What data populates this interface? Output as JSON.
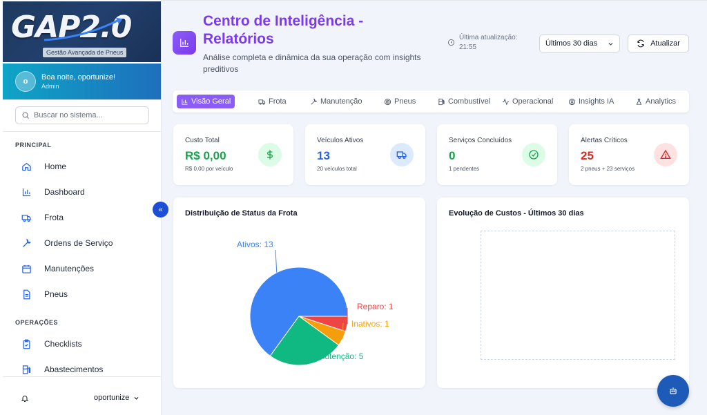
{
  "sidebar": {
    "logo_text": "GAP2.0",
    "logo_subtitle": "Gestão Avançada de Pneus",
    "user": {
      "initial": "o",
      "greeting": "Boa noite, oportunize!",
      "role": "Admin"
    },
    "search_placeholder": "Buscar no sistema...",
    "sections": [
      {
        "title": "PRINCIPAL",
        "items": [
          {
            "label": "Home",
            "icon": "home-icon"
          },
          {
            "label": "Dashboard",
            "icon": "bar-chart-icon"
          },
          {
            "label": "Frota",
            "icon": "truck-icon"
          },
          {
            "label": "Ordens de Serviço",
            "icon": "wrench-icon"
          },
          {
            "label": "Manutenções",
            "icon": "calendar-icon"
          },
          {
            "label": "Pneus",
            "icon": "document-icon"
          }
        ]
      },
      {
        "title": "OPERAÇÕES",
        "items": [
          {
            "label": "Checklists",
            "icon": "clipboard-check-icon"
          },
          {
            "label": "Abastecimentos",
            "icon": "fuel-icon"
          }
        ]
      }
    ],
    "footer_user": "oportunize"
  },
  "header": {
    "title": "Centro de Inteligência - Relatórios",
    "subtitle": "Análise completa e dinâmica da sua operação com insights preditivos",
    "last_update_label": "Última atualização:",
    "last_update_time": "21:55",
    "period_value": "Últimos 30 dias",
    "refresh_label": "Atualizar"
  },
  "tabs": [
    {
      "label": "Visão Geral",
      "icon": "bar-chart-icon",
      "active": true
    },
    {
      "label": "Frota",
      "icon": "truck-icon"
    },
    {
      "label": "Manutenção",
      "icon": "wrench-icon"
    },
    {
      "label": "Pneus",
      "icon": "target-icon"
    },
    {
      "label": "Combustível",
      "icon": "fuel-icon"
    },
    {
      "label": "Operacional",
      "icon": "activity-icon"
    },
    {
      "label": "Insights IA",
      "icon": "brain-icon"
    },
    {
      "label": "Analytics",
      "icon": "flask-icon"
    }
  ],
  "cards": [
    {
      "label": "Custo Total",
      "value": "R$ 0,00",
      "note": "R$ 0,00 por veículo",
      "color": "#16a34a",
      "icon_bg": "#dcfce7",
      "icon": "dollar-icon"
    },
    {
      "label": "Veículos Ativos",
      "value": "13",
      "note": "20 veículos total",
      "color": "#2563eb",
      "icon_bg": "#dbeafe",
      "icon": "truck-icon"
    },
    {
      "label": "Serviços Concluídos",
      "value": "0",
      "note": "1 pendentes",
      "color": "#16a34a",
      "icon_bg": "#dcfce7",
      "icon": "check-circle-icon"
    },
    {
      "label": "Alertas Críticos",
      "value": "25",
      "note": "2 pneus + 23 serviços",
      "color": "#dc2626",
      "icon_bg": "#fee2e2",
      "icon": "alert-triangle-icon"
    }
  ],
  "panels": {
    "status_title": "Distribuição de Status da Frota",
    "costs_title": "Evolução de Custos - Últimos 30 dias"
  },
  "chart_data": {
    "type": "pie",
    "title": "Distribuição de Status da Frota",
    "series": [
      {
        "name": "Ativos",
        "value": 13,
        "color": "#3b82f6",
        "label": "Ativos: 13"
      },
      {
        "name": "Reparo",
        "value": 1,
        "color": "#ef4444",
        "label": "Reparo: 1"
      },
      {
        "name": "Inativos",
        "value": 1,
        "color": "#f59e0b",
        "label": "Inativos: 1"
      },
      {
        "name": "Manutenção",
        "value": 5,
        "color": "#10b981",
        "label": "Manutenção: 5"
      }
    ]
  }
}
